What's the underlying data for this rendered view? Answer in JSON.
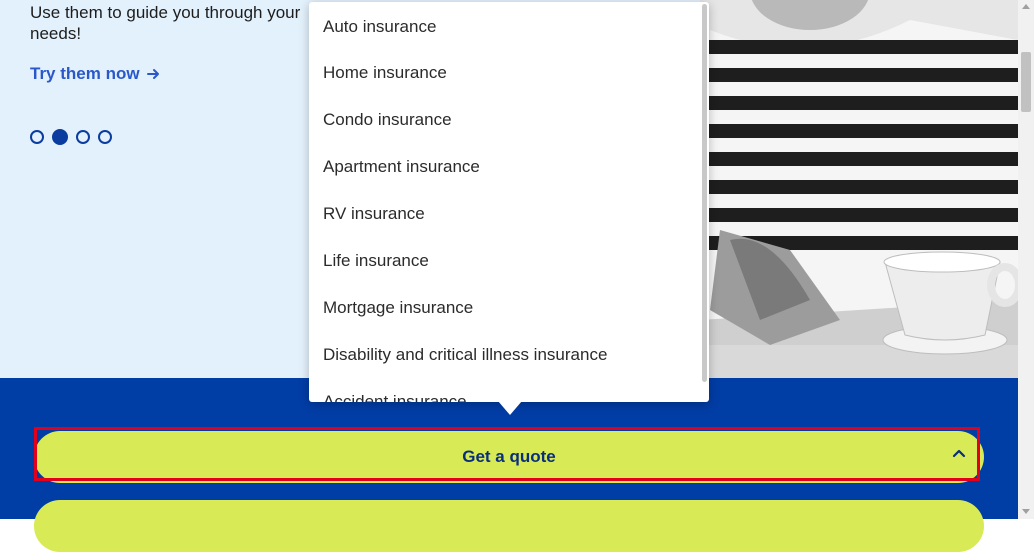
{
  "hero": {
    "text": "Use them to guide you through your needs!",
    "link_label": "Try them now"
  },
  "carousel": {
    "count": 4,
    "active_index": 1
  },
  "dropdown": {
    "items": [
      "Auto insurance",
      "Home insurance",
      "Condo insurance",
      "Apartment insurance",
      "RV insurance",
      "Life insurance",
      "Mortgage insurance",
      "Disability and critical illness insurance",
      "Accident insurance"
    ]
  },
  "cta": {
    "quote_label": "Get a quote",
    "expanded": true
  },
  "colors": {
    "hero_bg": "#e3f1fc",
    "brand_blue": "#003da5",
    "link_blue": "#2a58c9",
    "button_yellow": "#d8ea56",
    "highlight_red": "#e3001b"
  }
}
